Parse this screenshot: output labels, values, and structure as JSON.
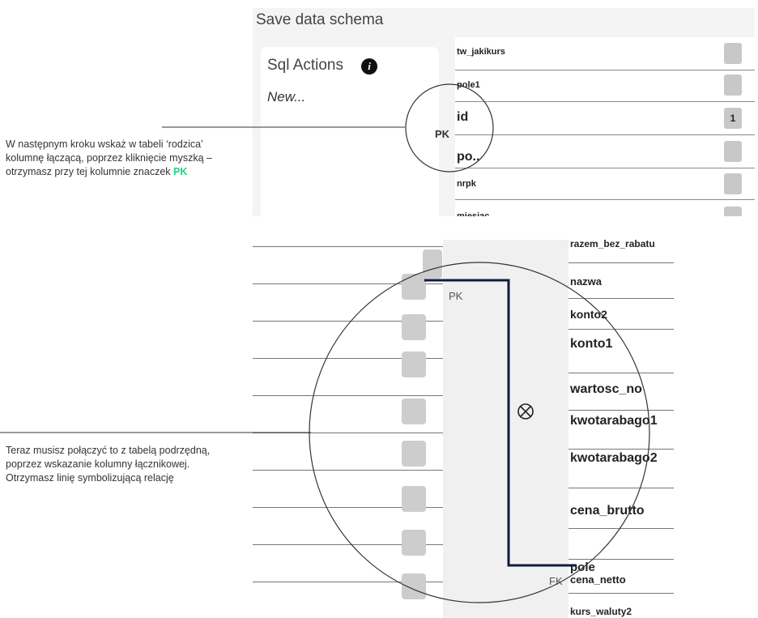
{
  "top": {
    "title": "Save data schema",
    "sql_panel": {
      "heading": "Sql Actions",
      "info_glyph": "i",
      "new_action": "New..."
    },
    "pk_label": "PK",
    "rows": [
      {
        "name": "tw_jakikurs",
        "value": ""
      },
      {
        "name": "pole1",
        "value": ""
      },
      {
        "name": "id",
        "value": "1"
      },
      {
        "name": "po..",
        "value": ""
      },
      {
        "name": "nrpk",
        "value": ""
      },
      {
        "name": "miesiac",
        "value": ""
      }
    ]
  },
  "caption1": {
    "text": "W następnym kroku wskaż w tabeli ‘rodzica’ kolumnę łączącą, poprzez kliknięcie myszką – otrzymasz przy tej kolumnie znaczek ",
    "highlight": "PK"
  },
  "bottom": {
    "pk_label": "PK",
    "fk_label": "FK",
    "relation_icon": "circle-x-icon",
    "right_rows": [
      {
        "name": "razem_bez_rabatu"
      },
      {
        "name": "nazwa"
      },
      {
        "name": "konto2"
      },
      {
        "name": "konto1"
      },
      {
        "name": "wartosc_no"
      },
      {
        "name": "kwotarabago1"
      },
      {
        "name": "kwotarabago2"
      },
      {
        "name": "cena_brutto"
      },
      {
        "name": "pole"
      },
      {
        "name": "cena_netto"
      },
      {
        "name": "kurs_waluty2"
      }
    ]
  },
  "caption2": {
    "text": "Teraz musisz połączyć to z tabelą podrzędną, poprzez wskazanie kolumny łącznikowej. Otrzymasz linię symbolizującą relację"
  },
  "colors": {
    "pk_highlight": "#1bd47d",
    "relation_line": "#0f1b3d"
  }
}
